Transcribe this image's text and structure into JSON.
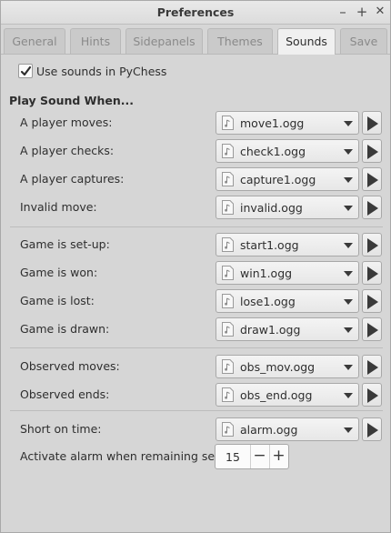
{
  "window": {
    "title": "Preferences",
    "minimize_symbol": "–",
    "maximize_symbol": "+",
    "close_symbol": "✕"
  },
  "tabs": [
    {
      "label": "General"
    },
    {
      "label": "Hints"
    },
    {
      "label": "Sidepanels"
    },
    {
      "label": "Themes"
    },
    {
      "label": "Sounds",
      "active": true
    },
    {
      "label": "Save"
    }
  ],
  "use_sounds": {
    "label": "Use sounds in PyChess",
    "checked": true
  },
  "section_title": "Play Sound When...",
  "sounds": [
    {
      "label": "A player moves:",
      "file": "move1.ogg"
    },
    {
      "label": "A player checks:",
      "file": "check1.ogg"
    },
    {
      "label": "A player captures:",
      "file": "capture1.ogg"
    },
    {
      "label": "Invalid move:",
      "file": "invalid.ogg"
    },
    {
      "label": "Game is set-up:",
      "file": "start1.ogg"
    },
    {
      "label": "Game is won:",
      "file": "win1.ogg"
    },
    {
      "label": "Game is lost:",
      "file": "lose1.ogg"
    },
    {
      "label": "Game is drawn:",
      "file": "draw1.ogg"
    },
    {
      "label": "Observed moves:",
      "file": "obs_mov.ogg"
    },
    {
      "label": "Observed ends:",
      "file": "obs_end.ogg"
    },
    {
      "label": "Short on time:",
      "file": "alarm.ogg"
    }
  ],
  "alarm": {
    "label": "Activate alarm when remaining sec is:",
    "value": "15",
    "minus_symbol": "−",
    "plus_symbol": "+"
  },
  "icons": {
    "checkbox": "checkmark-icon",
    "file": "audio-file-icon",
    "dropdown": "chevron-down-icon",
    "play": "play-icon"
  }
}
